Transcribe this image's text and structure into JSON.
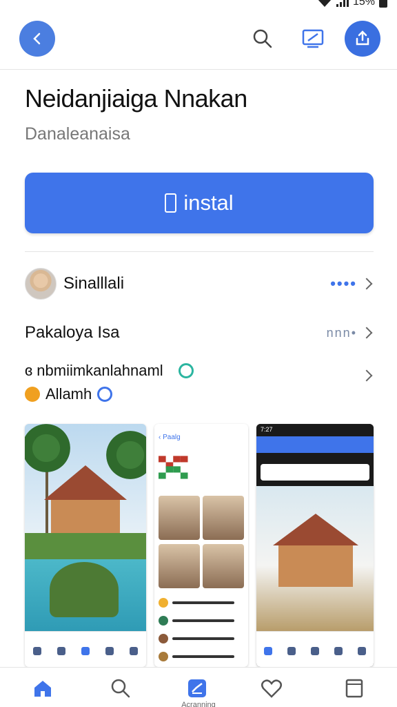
{
  "status_bar": {
    "battery_text": "15%"
  },
  "app": {
    "title": "Neidanjiaiga Nnakan",
    "subtitle": "Danaleanaisa",
    "install_label": "instal"
  },
  "rows": {
    "developer_name": "Sinalllali",
    "section_title": "Pakaloya Isa",
    "dots_blue": "••••",
    "dots_grey": "nnn•"
  },
  "tags": {
    "first": "ɞ nbmiimkanlahnaml",
    "second": "Allamh"
  },
  "screenshots": {
    "shot2_header": "‹ Paalg",
    "shot3_time": "7:27"
  },
  "bottom_nav": {
    "active_caption": "Acranning"
  },
  "colors": {
    "accent": "#3f74ea",
    "back_button": "#4b7ee0"
  }
}
